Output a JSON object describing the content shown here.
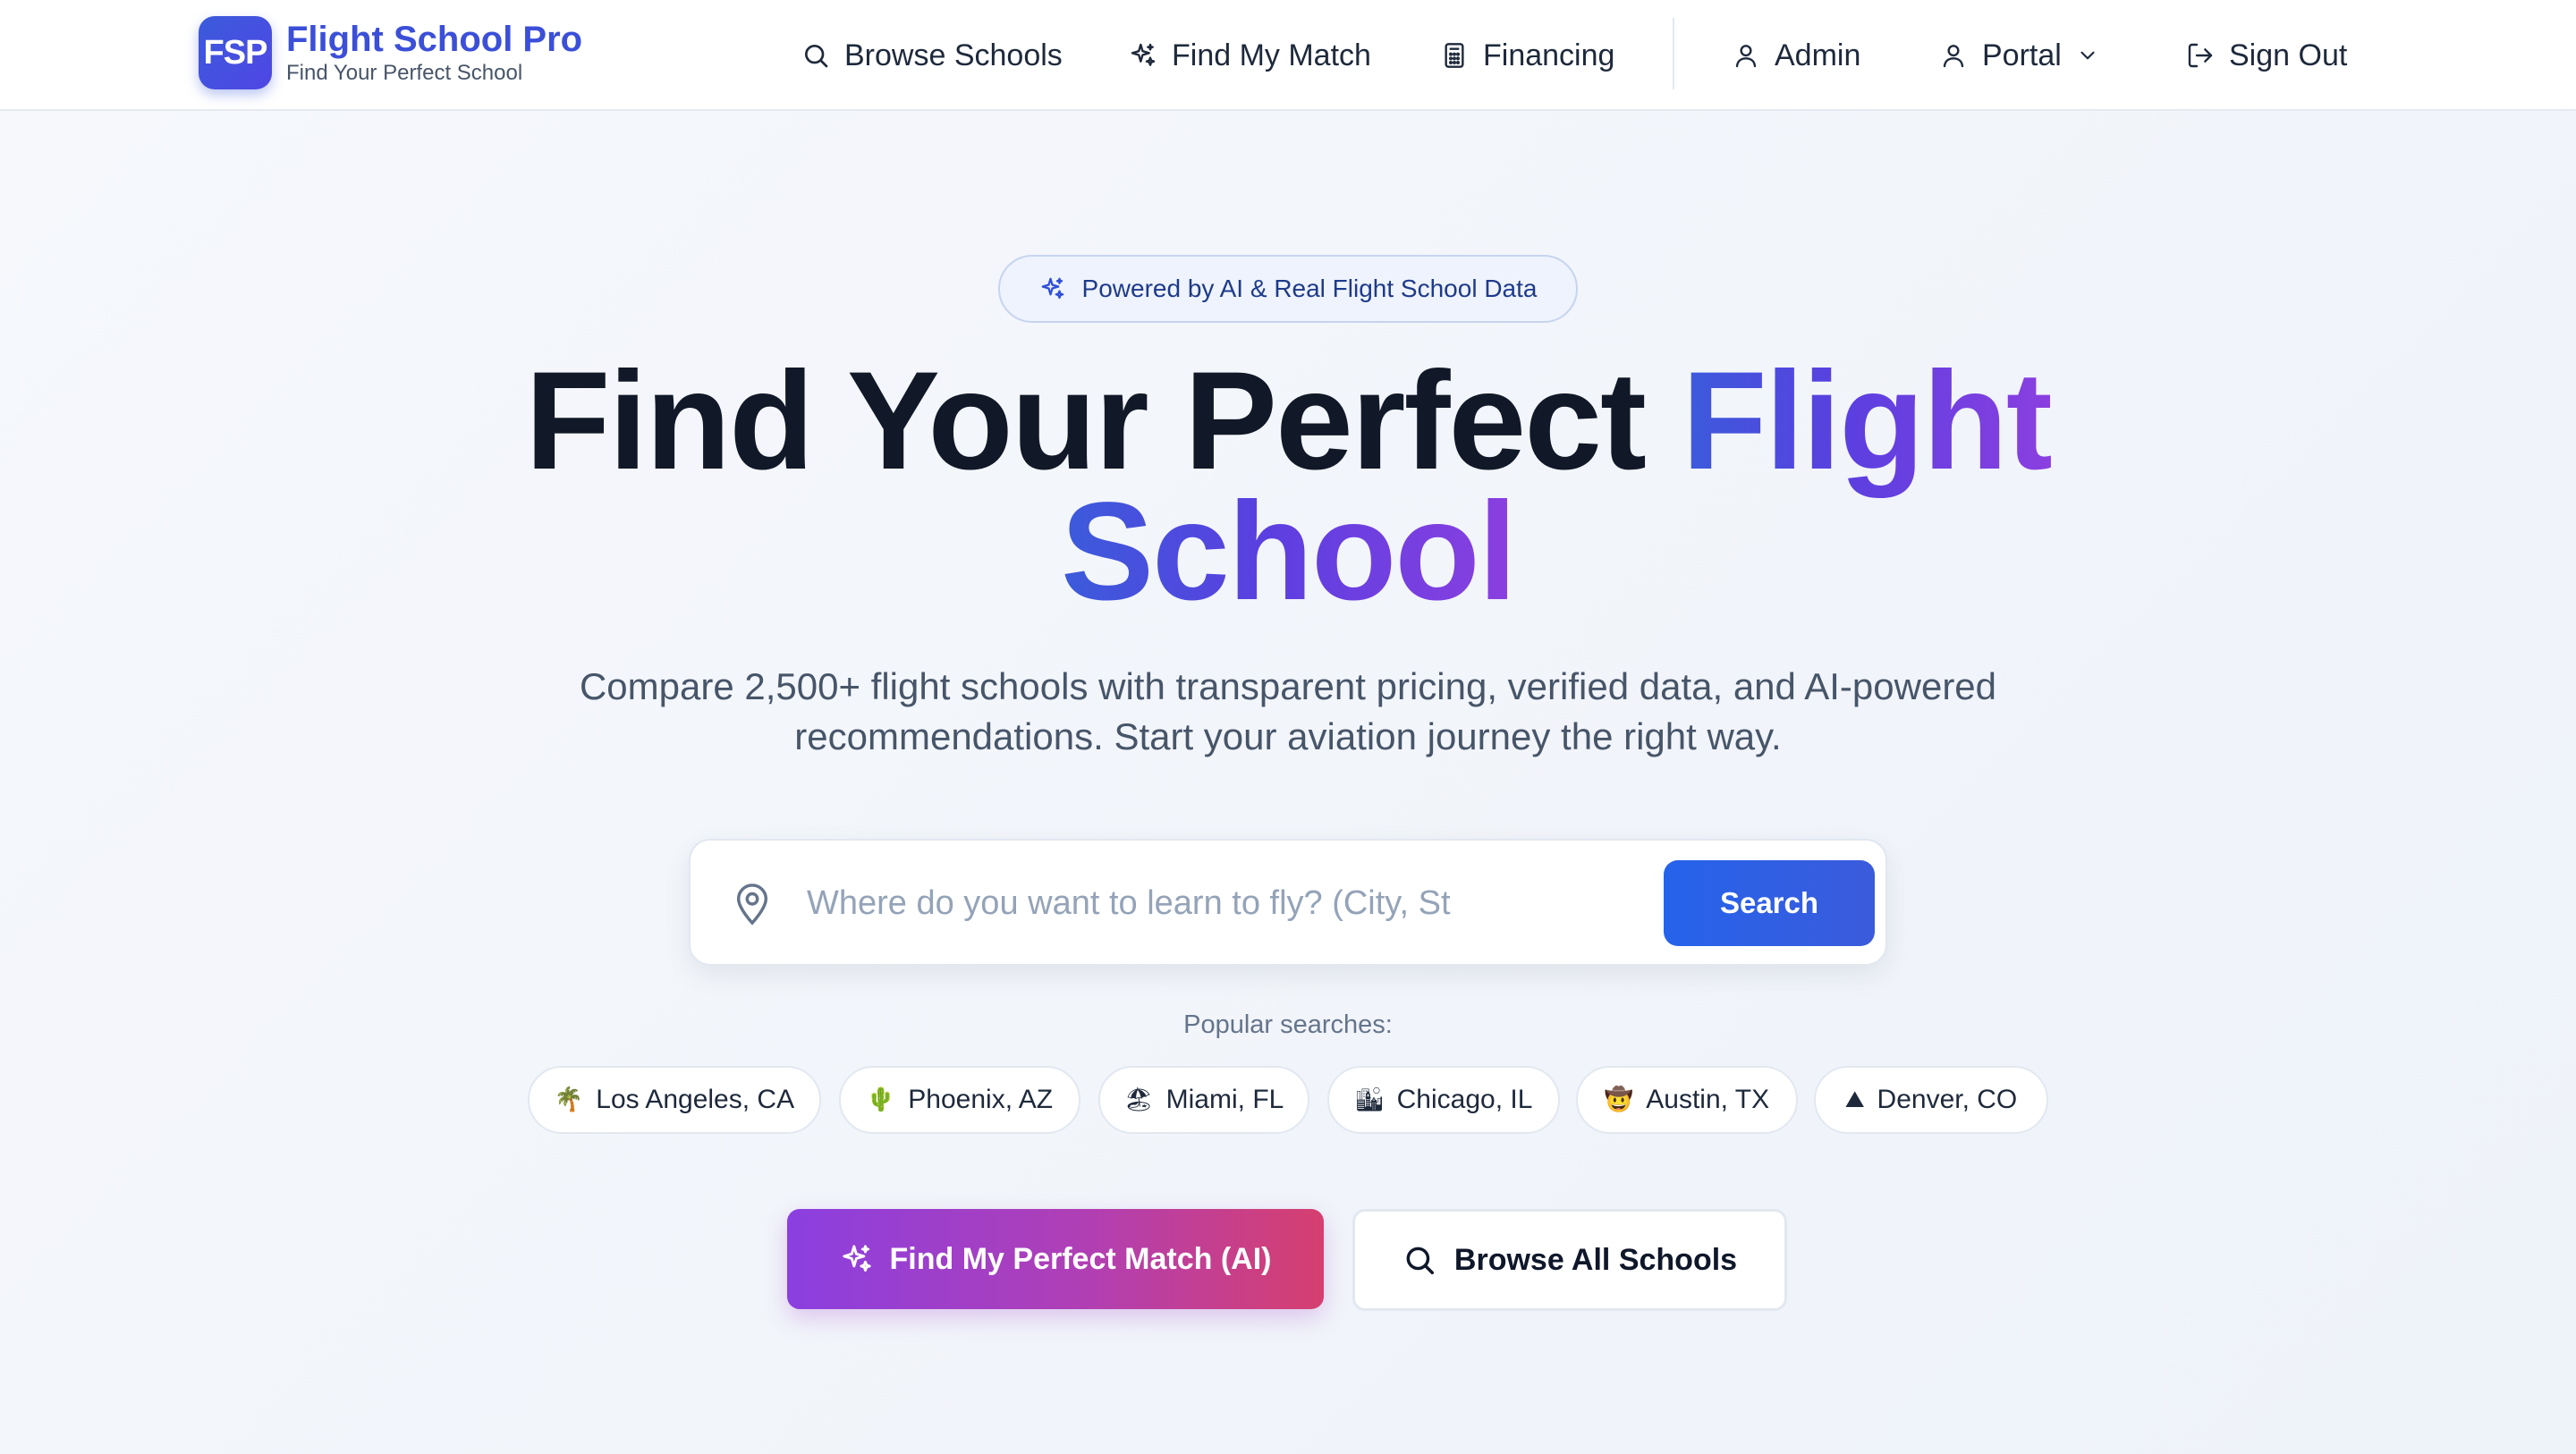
{
  "nav": {
    "logo_badge": "FSP",
    "logo_title": "Flight School Pro",
    "logo_subtitle": "Find Your Perfect School",
    "items": [
      {
        "label": "Browse Schools",
        "icon": "search-icon"
      },
      {
        "label": "Find My Match",
        "icon": "sparkles-icon"
      },
      {
        "label": "Financing",
        "icon": "calculator-icon"
      },
      {
        "label": "Admin",
        "icon": "user-icon"
      },
      {
        "label": "Portal",
        "icon": "user-icon"
      },
      {
        "label": "Sign Out",
        "icon": "sign-out-icon"
      }
    ]
  },
  "hero": {
    "badge": "Powered by AI & Real Flight School Data",
    "headline_plain": "Find Your Perfect",
    "headline_accent_1": "Flight",
    "headline_accent_2": "School",
    "subtext": "Compare 2,500+ flight schools with transparent pricing, verified data, and AI-powered recommendations. Start your aviation journey the right way."
  },
  "search": {
    "placeholder": "Where do you want to learn to fly? (City, State, or ZIP)",
    "value": "",
    "button_label": "Search"
  },
  "popular": {
    "label": "Popular searches:",
    "chips": [
      {
        "emoji": "🌴",
        "label": "Los Angeles, CA"
      },
      {
        "emoji": "🌵",
        "label": "Phoenix, AZ"
      },
      {
        "emoji": "🏖",
        "label": "Miami, FL"
      },
      {
        "emoji": "🏙",
        "label": "Chicago, IL"
      },
      {
        "emoji": "🤠",
        "label": "Austin, TX"
      },
      {
        "emoji": "⛰",
        "label": "Denver, CO"
      }
    ]
  },
  "cta": {
    "primary_label": "Find My Perfect Match (AI)",
    "secondary_label": "Browse All Schools"
  },
  "colors": {
    "brand": "#3b4fd8",
    "search_button": "#2563eb",
    "cta_gradient_start": "#8b3fe0",
    "cta_gradient_end": "#d63f6f"
  }
}
